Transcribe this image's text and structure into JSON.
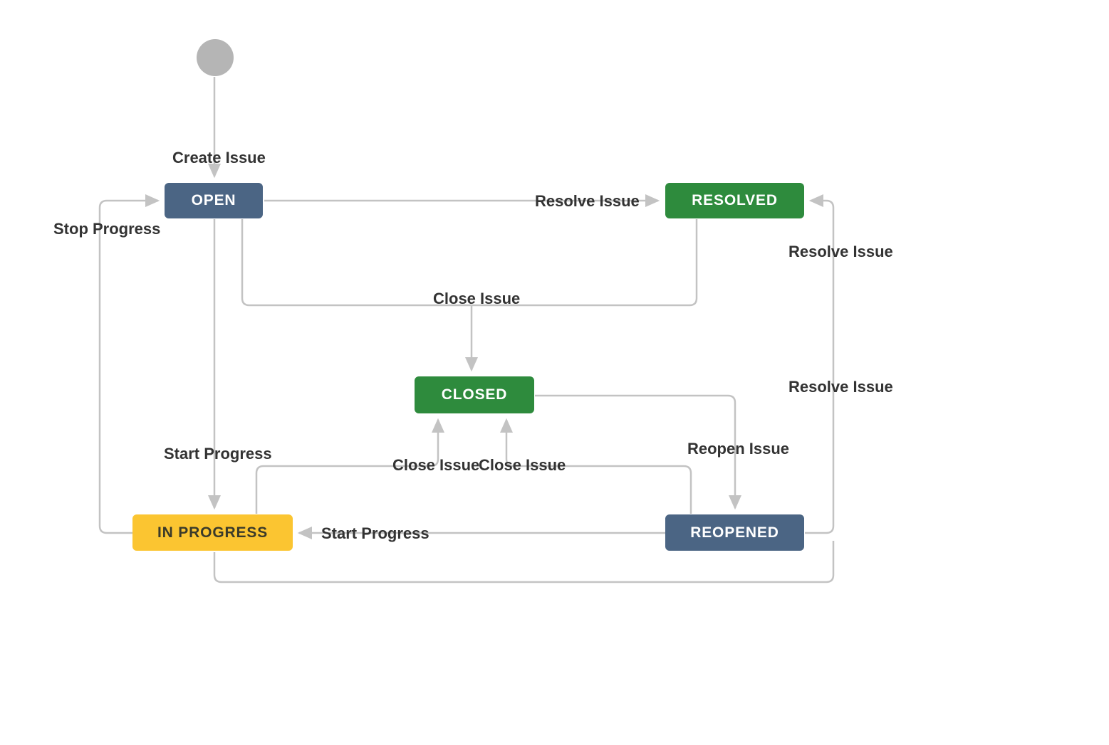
{
  "diagram_type": "state-machine",
  "states": {
    "start": {
      "kind": "initial"
    },
    "open": {
      "label": "OPEN",
      "color": "blue"
    },
    "resolved": {
      "label": "RESOLVED",
      "color": "green"
    },
    "closed": {
      "label": "CLOSED",
      "color": "green"
    },
    "in_progress": {
      "label": "IN PROGRESS",
      "color": "yellow"
    },
    "reopened": {
      "label": "REOPENED",
      "color": "blue"
    }
  },
  "transitions": {
    "create_issue": {
      "label": "Create Issue",
      "from": "start",
      "to": "open"
    },
    "resolve_issue": {
      "label": "Resolve Issue",
      "from": "open",
      "to": "resolved"
    },
    "close_issue_from_open": {
      "label": "Close Issue",
      "from": "open",
      "to": "closed"
    },
    "close_issue_from_resolved": {
      "label": "Close Issue",
      "from": "resolved",
      "to": "closed"
    },
    "start_progress": {
      "label": "Start Progress",
      "from": "open",
      "to": "in_progress"
    },
    "stop_progress": {
      "label": "Stop Progress",
      "from": "in_progress",
      "to": "open"
    },
    "close_issue_from_inprogress": {
      "label": "Close Issue",
      "from": "in_progress",
      "to": "closed"
    },
    "reopen_issue": {
      "label": "Reopen Issue",
      "from": "closed",
      "to": "reopened"
    },
    "start_progress_reopened": {
      "label": "Start Progress",
      "from": "reopened",
      "to": "in_progress"
    },
    "close_issue_from_reopened": {
      "label": "Close Issue",
      "from": "reopened",
      "to": "closed"
    },
    "resolve_issue_reopened": {
      "label": "Resolve Issue",
      "from": "reopened",
      "to": "resolved"
    },
    "resolve_issue_inprogress": {
      "label": "Resolve Issue",
      "from": "in_progress",
      "to": "resolved"
    }
  },
  "colors": {
    "blue": "#4b6584",
    "green": "#2e8b3d",
    "yellow": "#fbc531",
    "edge": "#c3c3c3",
    "text": "#333333"
  }
}
